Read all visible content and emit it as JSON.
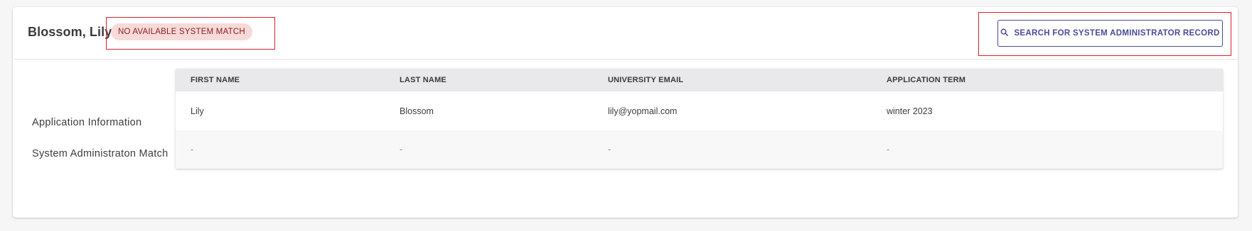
{
  "header": {
    "person_name": "Blossom, Lily",
    "status_badge": "NO AVAILABLE SYSTEM MATCH",
    "search_button_label": "SEARCH FOR SYSTEM ADMINISTRATOR RECORD",
    "search_icon": "search-icon"
  },
  "labels": {
    "application_information": "Application Information",
    "system_admin_match": "System Administraton Match"
  },
  "table": {
    "columns": [
      "FIRST NAME",
      "LAST NAME",
      "UNIVERSITY EMAIL",
      "APPLICATION TERM"
    ],
    "rows": [
      [
        "Lily",
        "Blossom",
        "lily@yopmail.com",
        "winter 2023"
      ],
      [
        "-",
        "-",
        "-",
        "-"
      ]
    ]
  },
  "colors": {
    "accent": "#4b4a9a",
    "badge_bg": "#f7dad9",
    "badge_text": "#8a1f1c",
    "highlight": "#e0212f"
  }
}
